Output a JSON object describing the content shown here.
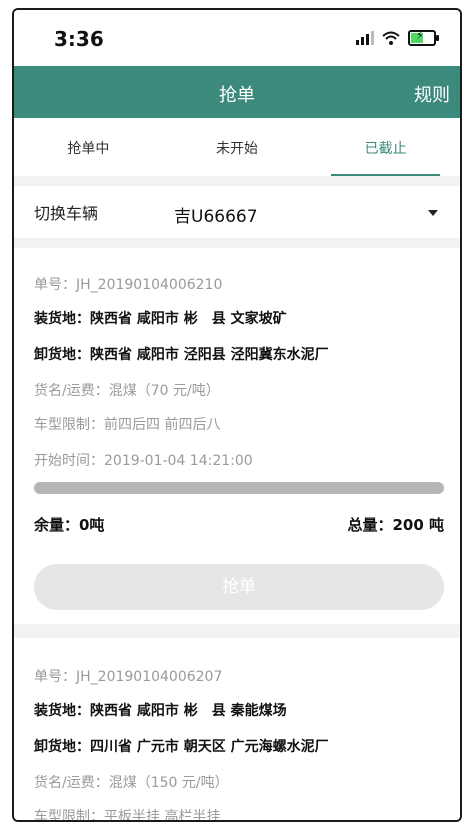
{
  "status_bar": {
    "time": "3:36"
  },
  "nav": {
    "title": "抢单",
    "right_action": "规则"
  },
  "tabs": [
    {
      "label": "抢单中",
      "active": false
    },
    {
      "label": "未开始",
      "active": false
    },
    {
      "label": "已截止",
      "active": true
    }
  ],
  "vehicle": {
    "label": "切换车辆",
    "value": "吉U66667"
  },
  "orders": [
    {
      "order_no": "单号：JH_20190104006210",
      "load": "装货地：陕西省 咸阳市 彬　县 文家坡矿",
      "unload": "卸货地：陕西省 咸阳市 泾阳县 泾阳冀东水泥厂",
      "goods": "货名/运费：混煤（70 元/吨）",
      "vehicle_limit": "车型限制：前四后四 前四后八",
      "start_time": "开始时间：2019-01-04 14:21:00",
      "progress": 1.0,
      "remaining": "余量：0吨",
      "total": "总量：200 吨",
      "button": "抢单"
    },
    {
      "order_no": "单号：JH_20190104006207",
      "load": "装货地：陕西省 咸阳市 彬　县 秦能煤场",
      "unload": "卸货地：四川省 广元市 朝天区 广元海螺水泥厂",
      "goods": "货名/运费：混煤（150 元/吨）",
      "vehicle_limit": "车型限制：平板半挂 高栏半挂"
    }
  ],
  "colors": {
    "brand": "#3c8a7c",
    "muted_text": "#9a9a9a",
    "disabled_button": "#e6e6e6"
  }
}
